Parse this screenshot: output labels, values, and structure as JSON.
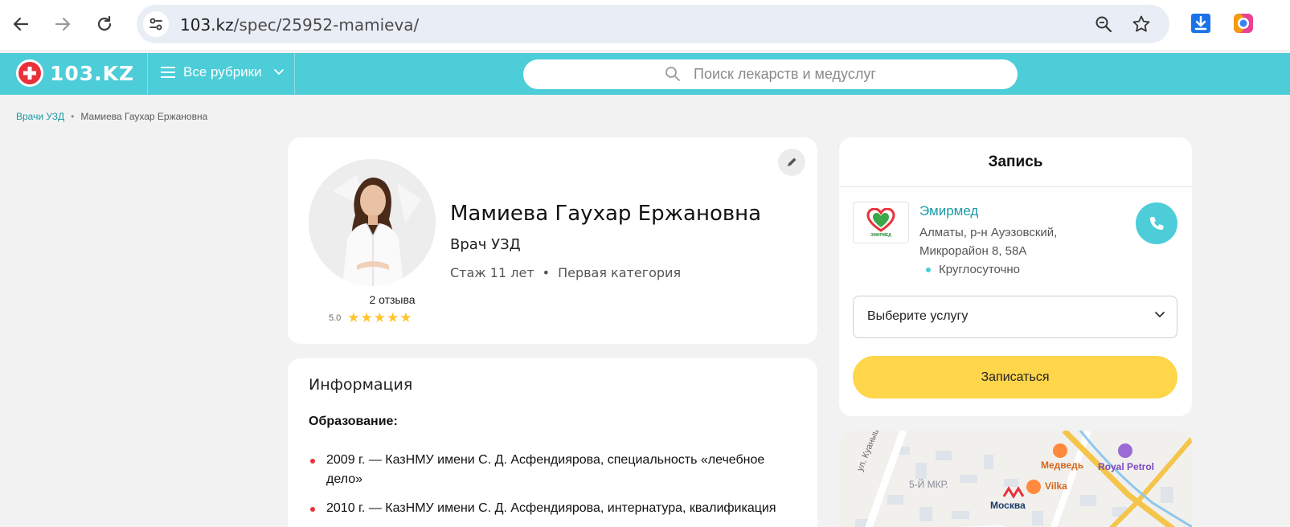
{
  "browser": {
    "url_host": "103.kz",
    "url_path": "/spec/25952-mamieva/",
    "icons": [
      "back-arrow-icon",
      "forward-arrow-icon",
      "reload-icon",
      "site-info-icon",
      "zoom-icon",
      "bookmark-star-icon",
      "download-icon",
      "extension-icon"
    ]
  },
  "header": {
    "logo_text": "103.KZ",
    "rubrics_label": "Все рубрики",
    "search_placeholder": "Поиск лекарств и медуслуг"
  },
  "breadcrumb": {
    "parent": "Врачи УЗД",
    "current": "Мамиева Гаухар Ержановна"
  },
  "profile": {
    "name": "Мамиева Гаухар Ержановна",
    "specialty": "Врач УЗД",
    "experience": "Стаж 11 лет",
    "category": "Первая категория",
    "reviews_count": "2 отзыва",
    "rating": "5.0",
    "rating_stars": 5
  },
  "info": {
    "title": "Информация",
    "education_label": "Образование:",
    "education": [
      "2009 г. — КазНМУ имени С. Д. Асфендиярова, специальность «лечебное дело»",
      "2010 г. — КазНМУ имени С. Д. Асфендиярова, интернатура, квалификация"
    ]
  },
  "booking": {
    "title": "Запись",
    "clinic_name": "Эмирмед",
    "clinic_address": "Алматы, р-н Ауэзовский, Микрорайон 8, 58А",
    "clinic_hours": "Круглосуточно",
    "clinic_logo_text": "ЭМИРМЕД",
    "service_placeholder": "Выберите услугу",
    "book_label": "Записаться"
  },
  "map": {
    "labels": {
      "street1": "ул. Куанышбае",
      "district": "5-Й МКР.",
      "metro": "Москва",
      "medved": "Медведь",
      "vilka": "Vilka",
      "royal_petrol": "Royal Petrol"
    }
  },
  "colors": {
    "brand_teal": "#4ccdd8",
    "brand_red": "#e8313a",
    "button_yellow": "#ffd54a",
    "star_yellow": "#ffc52e",
    "link_teal": "#1a9aa6"
  }
}
